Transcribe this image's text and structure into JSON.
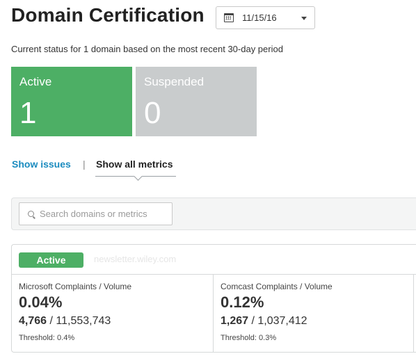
{
  "header": {
    "title": "Domain Certification",
    "date": "11/15/16"
  },
  "status_line": "Current status for 1 domain based on the most recent 30-day period",
  "tiles": [
    {
      "label": "Active",
      "count": "1",
      "color": "#4daf65"
    },
    {
      "label": "Suspended",
      "count": "0",
      "color": "#c9cccd"
    }
  ],
  "tabs": {
    "issues": "Show issues",
    "separator": "|",
    "metrics": "Show all metrics"
  },
  "search": {
    "placeholder": "Search domains or metrics"
  },
  "domain_card": {
    "status_badge": "Active",
    "domain_name": "newsletter.wiley.com",
    "metrics": [
      {
        "label": "Microsoft Complaints / Volume",
        "percent": "0.04%",
        "complaints": "4,766",
        "volume": " / 11,553,743",
        "threshold": "Threshold: 0.4%"
      },
      {
        "label": "Comcast Complaints / Volume",
        "percent": "0.12%",
        "complaints": "1,267",
        "volume": " / 1,037,412",
        "threshold": "Threshold: 0.3%"
      }
    ]
  },
  "colors": {
    "accent_green": "#4daf65",
    "link_blue": "#1a8bbf",
    "suspended_gray": "#c9cccd"
  }
}
